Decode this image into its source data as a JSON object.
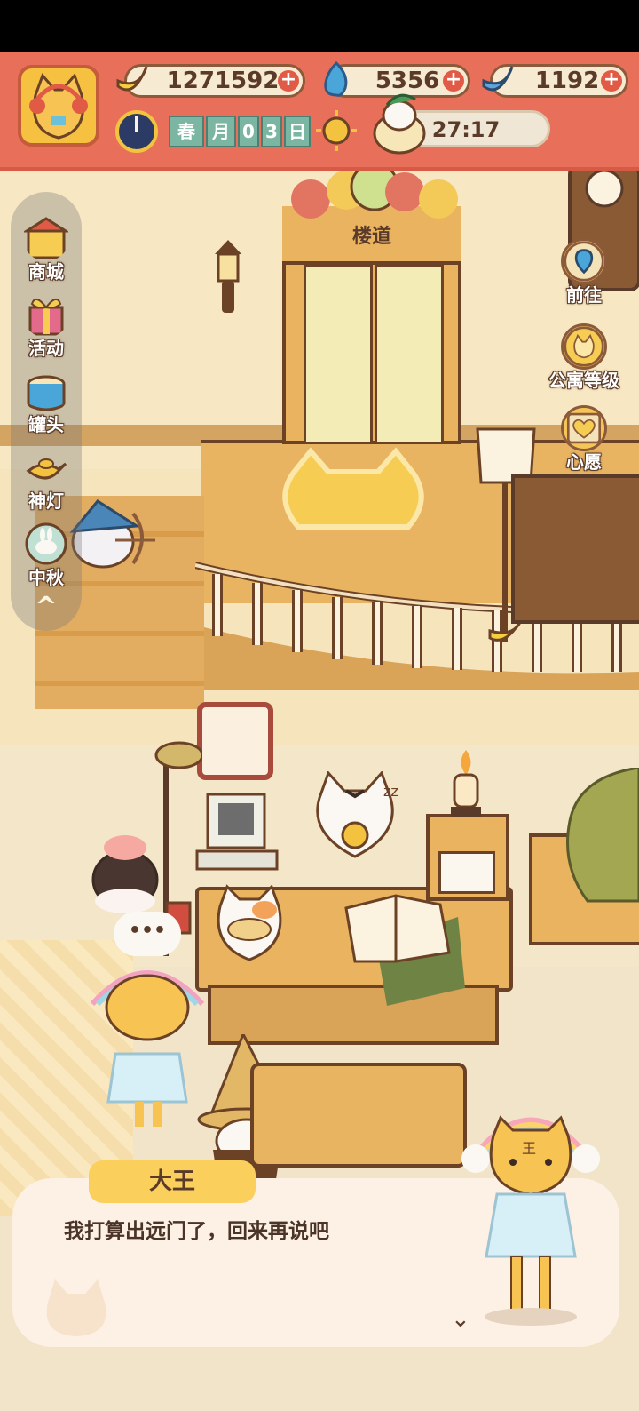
{
  "hud": {
    "currencies": [
      {
        "name": "banana",
        "value": "1271592"
      },
      {
        "name": "blue-flame",
        "value": "5356"
      },
      {
        "name": "blue-banana",
        "value": "1192"
      }
    ],
    "date": {
      "season": "春",
      "month": "月",
      "day_tens": "0",
      "day_ones": "3",
      "day_suffix": "日"
    },
    "timer": "27:17"
  },
  "sidebar": {
    "items": [
      {
        "label": "商城",
        "icon": "shop-icon"
      },
      {
        "label": "活动",
        "icon": "gift-icon"
      },
      {
        "label": "罐头",
        "icon": "can-icon"
      },
      {
        "label": "神灯",
        "icon": "lamp-icon"
      },
      {
        "label": "中秋",
        "icon": "moon-rabbit-icon"
      }
    ],
    "collapse": "^"
  },
  "right_menu": {
    "items": [
      {
        "label": "前往",
        "icon": "map-pin-icon"
      },
      {
        "label": "公寓等级",
        "icon": "cat-badge-icon"
      },
      {
        "label": "心愿",
        "icon": "heart-book-icon"
      }
    ]
  },
  "scene": {
    "door_sign": "楼道",
    "thought_bubble": "•••"
  },
  "dialog": {
    "speaker": "大王",
    "text": "我打算出远门了，回来再说吧",
    "next": "⌄"
  },
  "colors": {
    "hud_red": "#e8705a",
    "wood": "#e9b35f",
    "dialog_bg": "#fdf0e4",
    "name_tag": "#fbcf5c"
  }
}
